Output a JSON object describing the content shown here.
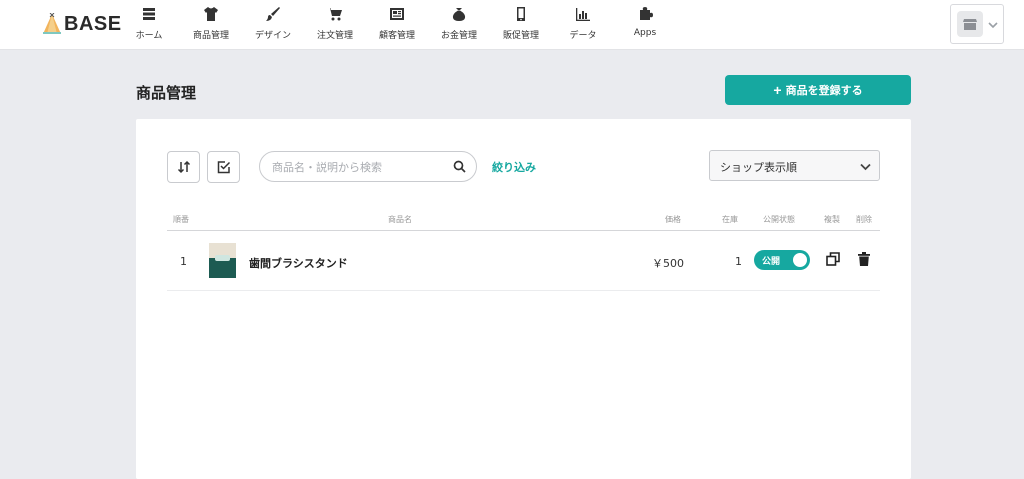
{
  "brand": {
    "name": "BASE"
  },
  "nav": {
    "items": [
      {
        "label": "ホーム",
        "icon": "home-list-icon"
      },
      {
        "label": "商品管理",
        "icon": "tshirt-icon"
      },
      {
        "label": "デザイン",
        "icon": "brush-icon"
      },
      {
        "label": "注文管理",
        "icon": "cart-icon"
      },
      {
        "label": "顧客管理",
        "icon": "id-card-icon"
      },
      {
        "label": "お金管理",
        "icon": "wallet-icon"
      },
      {
        "label": "販促管理",
        "icon": "phone-icon"
      },
      {
        "label": "データ",
        "icon": "bar-chart-icon"
      },
      {
        "label": "Apps",
        "icon": "puzzle-icon"
      }
    ]
  },
  "page": {
    "title": "商品管理",
    "register_label": "商品を登録する",
    "register_plus": "+"
  },
  "toolbar": {
    "search_placeholder": "商品名・説明から検索",
    "filter_label": "絞り込み",
    "sort_value": "ショップ表示順"
  },
  "table": {
    "headers": {
      "order": "順番",
      "name": "商品名",
      "price": "価格",
      "stock": "在庫",
      "status": "公開状態",
      "copy": "複製",
      "delete": "削除"
    },
    "rows": [
      {
        "order": "1",
        "name": "歯間ブラシスタンド",
        "price": "￥500",
        "stock": "1",
        "status": "公開",
        "status_on": true
      }
    ]
  },
  "colors": {
    "accent": "#16a8a0",
    "background": "#eaebef"
  }
}
